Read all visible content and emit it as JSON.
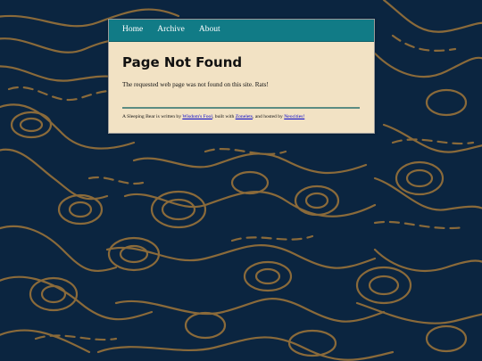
{
  "nav": {
    "items": [
      {
        "label": "Home"
      },
      {
        "label": "Archive"
      },
      {
        "label": "About"
      }
    ]
  },
  "main": {
    "title": "Page Not Found",
    "message": "The requested web page was not found on this site. Rats!"
  },
  "footer": {
    "prefix": "A Sleeping Bear is written by ",
    "author_link": "Wisdom's Fool",
    "middle": ", built with ",
    "builder_link": "Zonelets",
    "middle2": ", and hosted by ",
    "host_link": "Neocities!"
  },
  "colors": {
    "background": "#0b2540",
    "contour": "#8a6a3a",
    "nav": "#117b86",
    "card": "#f2e2c4",
    "divider": "#5c8c83",
    "link": "#0000cc"
  }
}
